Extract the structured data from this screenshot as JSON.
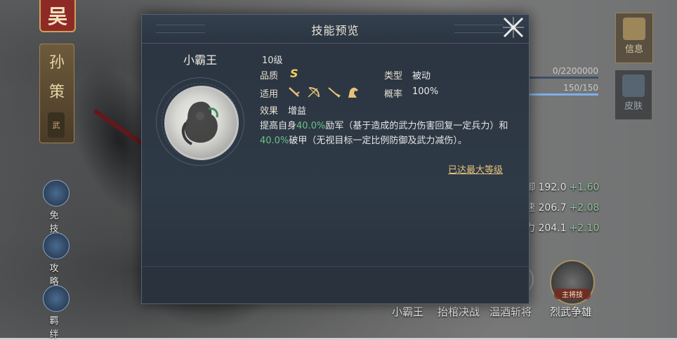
{
  "hero": {
    "seal_char": "吴",
    "name_chars": [
      "孙",
      "策"
    ],
    "tag": "武",
    "side_buttons": [
      {
        "label": "免 技",
        "icon": "bird-icon"
      },
      {
        "label": "攻 略",
        "icon": "scroll-icon"
      },
      {
        "label": "羁 绊",
        "icon": "book-icon"
      }
    ]
  },
  "right_panel": {
    "tabs": [
      {
        "label": "信息",
        "icon": "scroll-icon"
      },
      {
        "label": "皮肤",
        "icon": "figure-icon"
      }
    ],
    "exp_text": "0/2200000",
    "level_text": "150/150",
    "level_fill_fraction": 1.0,
    "stats": [
      {
        "name": "御",
        "value": "192.0",
        "bonus": "+1.60"
      },
      {
        "name": "速",
        "value": "206.7",
        "bonus": "+2.08"
      },
      {
        "name": "力",
        "value": "204.1",
        "bonus": "+2.10"
      }
    ],
    "leader_skill_label": "主将技",
    "skill_names": [
      "小霸王",
      "抬棺决战",
      "温酒斩将",
      "烈武争雄"
    ]
  },
  "modal": {
    "title": "技能预览",
    "skill_name": "小霸王",
    "level": "10级",
    "quality_label": "品质",
    "quality_value": "S",
    "type_label": "类型",
    "type_value": "被动",
    "applies_label": "适用",
    "applies_icons": [
      "sword-icon",
      "bow-icon",
      "spear-icon",
      "horse-icon"
    ],
    "rate_label": "概率",
    "rate_value": "100%",
    "effect_label": "效果",
    "effect_value": "增益",
    "desc_parts": {
      "p1": "提高自身",
      "v1": "40.0%",
      "p2": "励军（基于造成的武力伤害回复一定兵力）和",
      "v2": "40.0%",
      "p3": "破甲（无视目标一定比例防御及武力减伤）。"
    },
    "max_level_link": "已达最大等级"
  }
}
